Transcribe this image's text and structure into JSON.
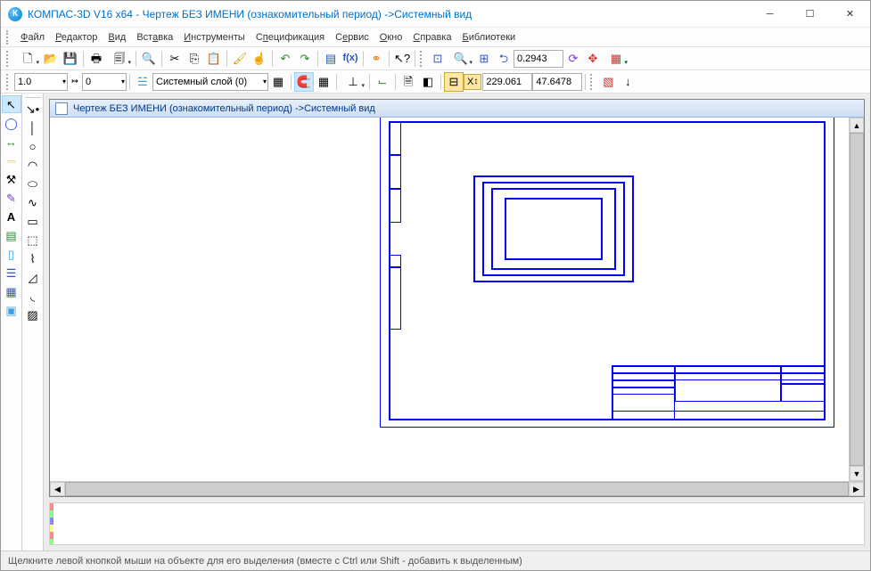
{
  "title": "КОМПАС-3D V16  x64 - Чертеж БЕЗ ИМЕНИ (ознакомительный период) ->Системный вид",
  "menus": [
    "Файл",
    "Редактор",
    "Вид",
    "Вставка",
    "Инструменты",
    "Спецификация",
    "Сервис",
    "Окно",
    "Справка",
    "Библиотеки"
  ],
  "toolbar2": {
    "scale_value": "1.0",
    "step_value": "0",
    "layer_label": "Системный слой (0)"
  },
  "zoom_value": "0.2943",
  "coords": {
    "x_label": "X",
    "x_value": "229.061",
    "y_value": "47.6478"
  },
  "doc_title": "Чертеж БЕЗ ИМЕНИ (ознакомительный период) ->Системный вид",
  "status": "Щелкните левой кнопкой мыши на объекте для его выделения (вместе с Ctrl или Shift - добавить к выделенным)"
}
